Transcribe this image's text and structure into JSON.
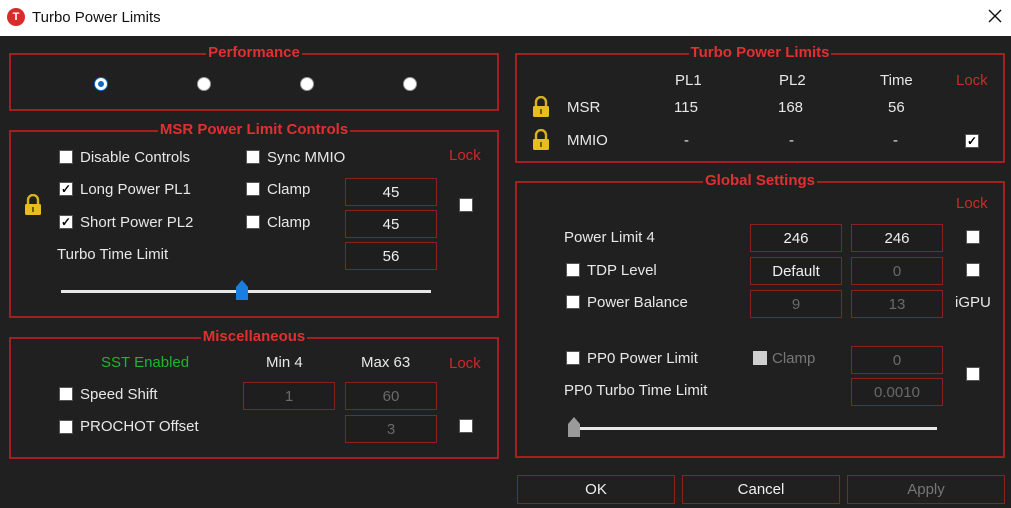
{
  "window": {
    "title": "Turbo Power Limits",
    "icon_letter": "T"
  },
  "performance": {
    "title": "Performance",
    "options": [
      "opt1",
      "opt2",
      "opt3",
      "opt4"
    ],
    "selected_index": 0
  },
  "msr": {
    "title": "MSR Power Limit Controls",
    "lock_label": "Lock",
    "disable_controls": {
      "label": "Disable Controls",
      "checked": false
    },
    "sync_mmio": {
      "label": "Sync MMIO",
      "checked": false
    },
    "long_power": {
      "label": "Long Power PL1",
      "checked": true,
      "clamp_label": "Clamp",
      "clamp_checked": false,
      "value": "45"
    },
    "short_power": {
      "label": "Short Power PL2",
      "checked": true,
      "clamp_label": "Clamp",
      "clamp_checked": false,
      "value": "45"
    },
    "turbo_time": {
      "label": "Turbo Time Limit",
      "value": "56"
    },
    "lock_checked": false,
    "slider_fraction": 0.49
  },
  "misc": {
    "title": "Miscellaneous",
    "sst_label": "SST Enabled",
    "min_label": "Min  4",
    "max_label": "Max  63",
    "lock_label": "Lock",
    "speed_shift": {
      "label": "Speed Shift",
      "checked": false,
      "min_value": "1",
      "max_value": "60"
    },
    "prochot": {
      "label": "PROCHOT Offset",
      "checked": false,
      "value": "3"
    },
    "lock_checked": false
  },
  "turbo_limits": {
    "title": "Turbo Power Limits",
    "headers": {
      "pl1": "PL1",
      "pl2": "PL2",
      "time": "Time",
      "lock": "Lock"
    },
    "rows": [
      {
        "name": "MSR",
        "pl1": "115",
        "pl2": "168",
        "time": "56",
        "lock_checked": null
      },
      {
        "name": "MMIO",
        "pl1": "-",
        "pl2": "-",
        "time": "-",
        "lock_checked": true
      }
    ]
  },
  "global": {
    "title": "Global Settings",
    "lock_label": "Lock",
    "power_limit_4": {
      "label": "Power Limit 4",
      "value1": "246",
      "value2": "246",
      "lock_checked": false
    },
    "tdp_level": {
      "label": "TDP Level",
      "checked": false,
      "value1": "Default",
      "value2": "0",
      "lock_checked": false
    },
    "power_balance": {
      "label": "Power Balance",
      "checked": false,
      "value1": "9",
      "value2": "13",
      "igpu_label": "iGPU"
    },
    "pp0_power_limit": {
      "label": "PP0 Power Limit",
      "checked": false,
      "clamp_label": "Clamp",
      "clamp_checked": false,
      "value": "0"
    },
    "pp0_turbo_time": {
      "label": "PP0 Turbo Time Limit",
      "value": "0.0010"
    },
    "pp0_lock_checked": false,
    "slider_fraction": 0.0
  },
  "buttons": {
    "ok": "OK",
    "cancel": "Cancel",
    "apply": "Apply"
  }
}
